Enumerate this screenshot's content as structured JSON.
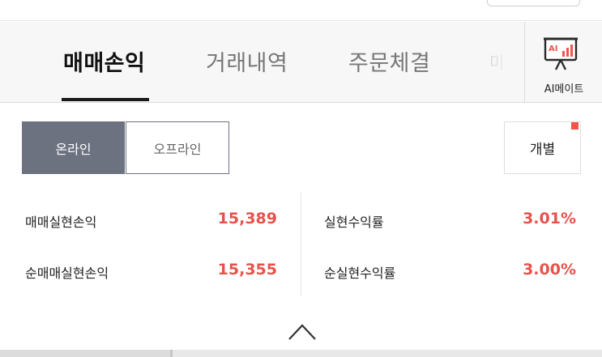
{
  "tabs": [
    {
      "label": "매매손익",
      "active": true
    },
    {
      "label": "거래내역",
      "active": false
    },
    {
      "label": "주문체결",
      "active": false
    },
    {
      "label": "미",
      "active": false
    }
  ],
  "ai_button": {
    "label": "AI메이트",
    "icon": "ai-presentation-chart-icon",
    "icon_text": "AI"
  },
  "mode_toggle": {
    "options": [
      "온라인",
      "오프라인"
    ],
    "selected": "온라인"
  },
  "individual_button": {
    "label": "개별",
    "has_notification": true
  },
  "stats": {
    "left": [
      {
        "label": "매매실현손익",
        "value": "15,389"
      },
      {
        "label": "순매매실현손익",
        "value": "15,355"
      }
    ],
    "right": [
      {
        "label": "실현수익률",
        "value": "3.01%"
      },
      {
        "label": "순실현수익률",
        "value": "3.00%"
      }
    ]
  },
  "collapse_icon": "chevron-up-icon",
  "colors": {
    "accent_red": "#e5534b",
    "segment_active": "#6d7281",
    "ai_icon_orange": "#f0554a",
    "notification_dot": "#f0554a"
  }
}
